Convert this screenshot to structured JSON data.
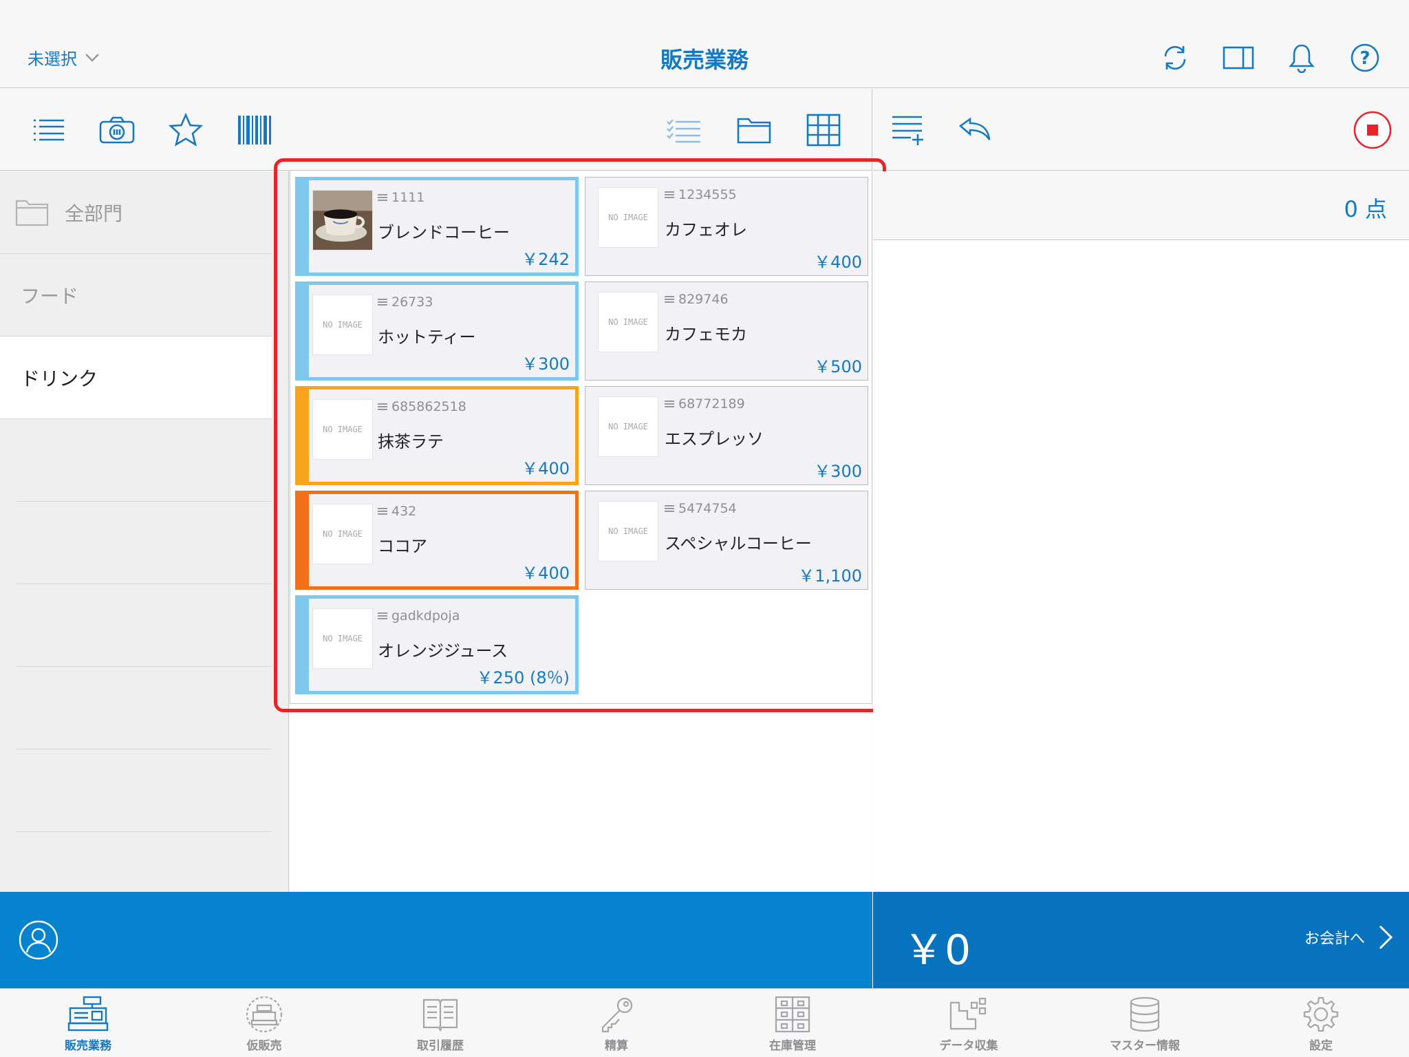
{
  "header": {
    "selector_label": "未選択",
    "title": "販売業務"
  },
  "departments": {
    "all_label": "全部門",
    "items": [
      {
        "label": "フード"
      },
      {
        "label": "ドリンク"
      }
    ]
  },
  "products": [
    {
      "code": "1111",
      "name": "ブレンドコーヒー",
      "price": "￥242",
      "color": "#7cc8ef",
      "image": "coffee-photo"
    },
    {
      "code": "1234555",
      "name": "カフェオレ",
      "price": "￥400",
      "color": "",
      "image": "NO IMAGE"
    },
    {
      "code": "26733",
      "name": "ホットティー",
      "price": "￥300",
      "color": "#7cc8ef",
      "image": "NO IMAGE"
    },
    {
      "code": "829746",
      "name": "カフェモカ",
      "price": "￥500",
      "color": "",
      "image": "NO IMAGE"
    },
    {
      "code": "685862518",
      "name": "抹茶ラテ",
      "price": "￥400",
      "color": "#f7a41c",
      "image": "NO IMAGE"
    },
    {
      "code": "68772189",
      "name": "エスプレッソ",
      "price": "￥300",
      "color": "",
      "image": "NO IMAGE"
    },
    {
      "code": "432",
      "name": "ココア",
      "price": "￥400",
      "color": "#f0711a",
      "image": "NO IMAGE"
    },
    {
      "code": "5474754",
      "name": "スペシャルコーヒー",
      "price": "￥1,100",
      "color": "",
      "image": "NO IMAGE"
    },
    {
      "code": "gadkdpoja",
      "name": "オレンジジュース",
      "price": "￥250 (8％)",
      "color": "#7cc8ef",
      "image": "NO IMAGE"
    }
  ],
  "cart": {
    "count": "0 点",
    "total": "￥0",
    "checkout_label": "お会計へ"
  },
  "tabs": [
    {
      "label": "販売業務",
      "icon": "cash-register-icon",
      "active": true
    },
    {
      "label": "仮販売",
      "icon": "temporary-sale-icon",
      "active": false
    },
    {
      "label": "取引履歴",
      "icon": "transaction-history-icon",
      "active": false
    },
    {
      "label": "精算",
      "icon": "key-icon",
      "active": false
    },
    {
      "label": "在庫管理",
      "icon": "inventory-icon",
      "active": false
    },
    {
      "label": "データ収集",
      "icon": "data-collection-icon",
      "active": false
    },
    {
      "label": "マスター情報",
      "icon": "database-icon",
      "active": false
    },
    {
      "label": "設定",
      "icon": "gear-icon",
      "active": false
    }
  ],
  "colors": {
    "accent": "#1579c2",
    "bar_left": "#0683cf",
    "bar_right": "#0772be",
    "highlight": "#e8242b",
    "stop": "#e8242b"
  }
}
